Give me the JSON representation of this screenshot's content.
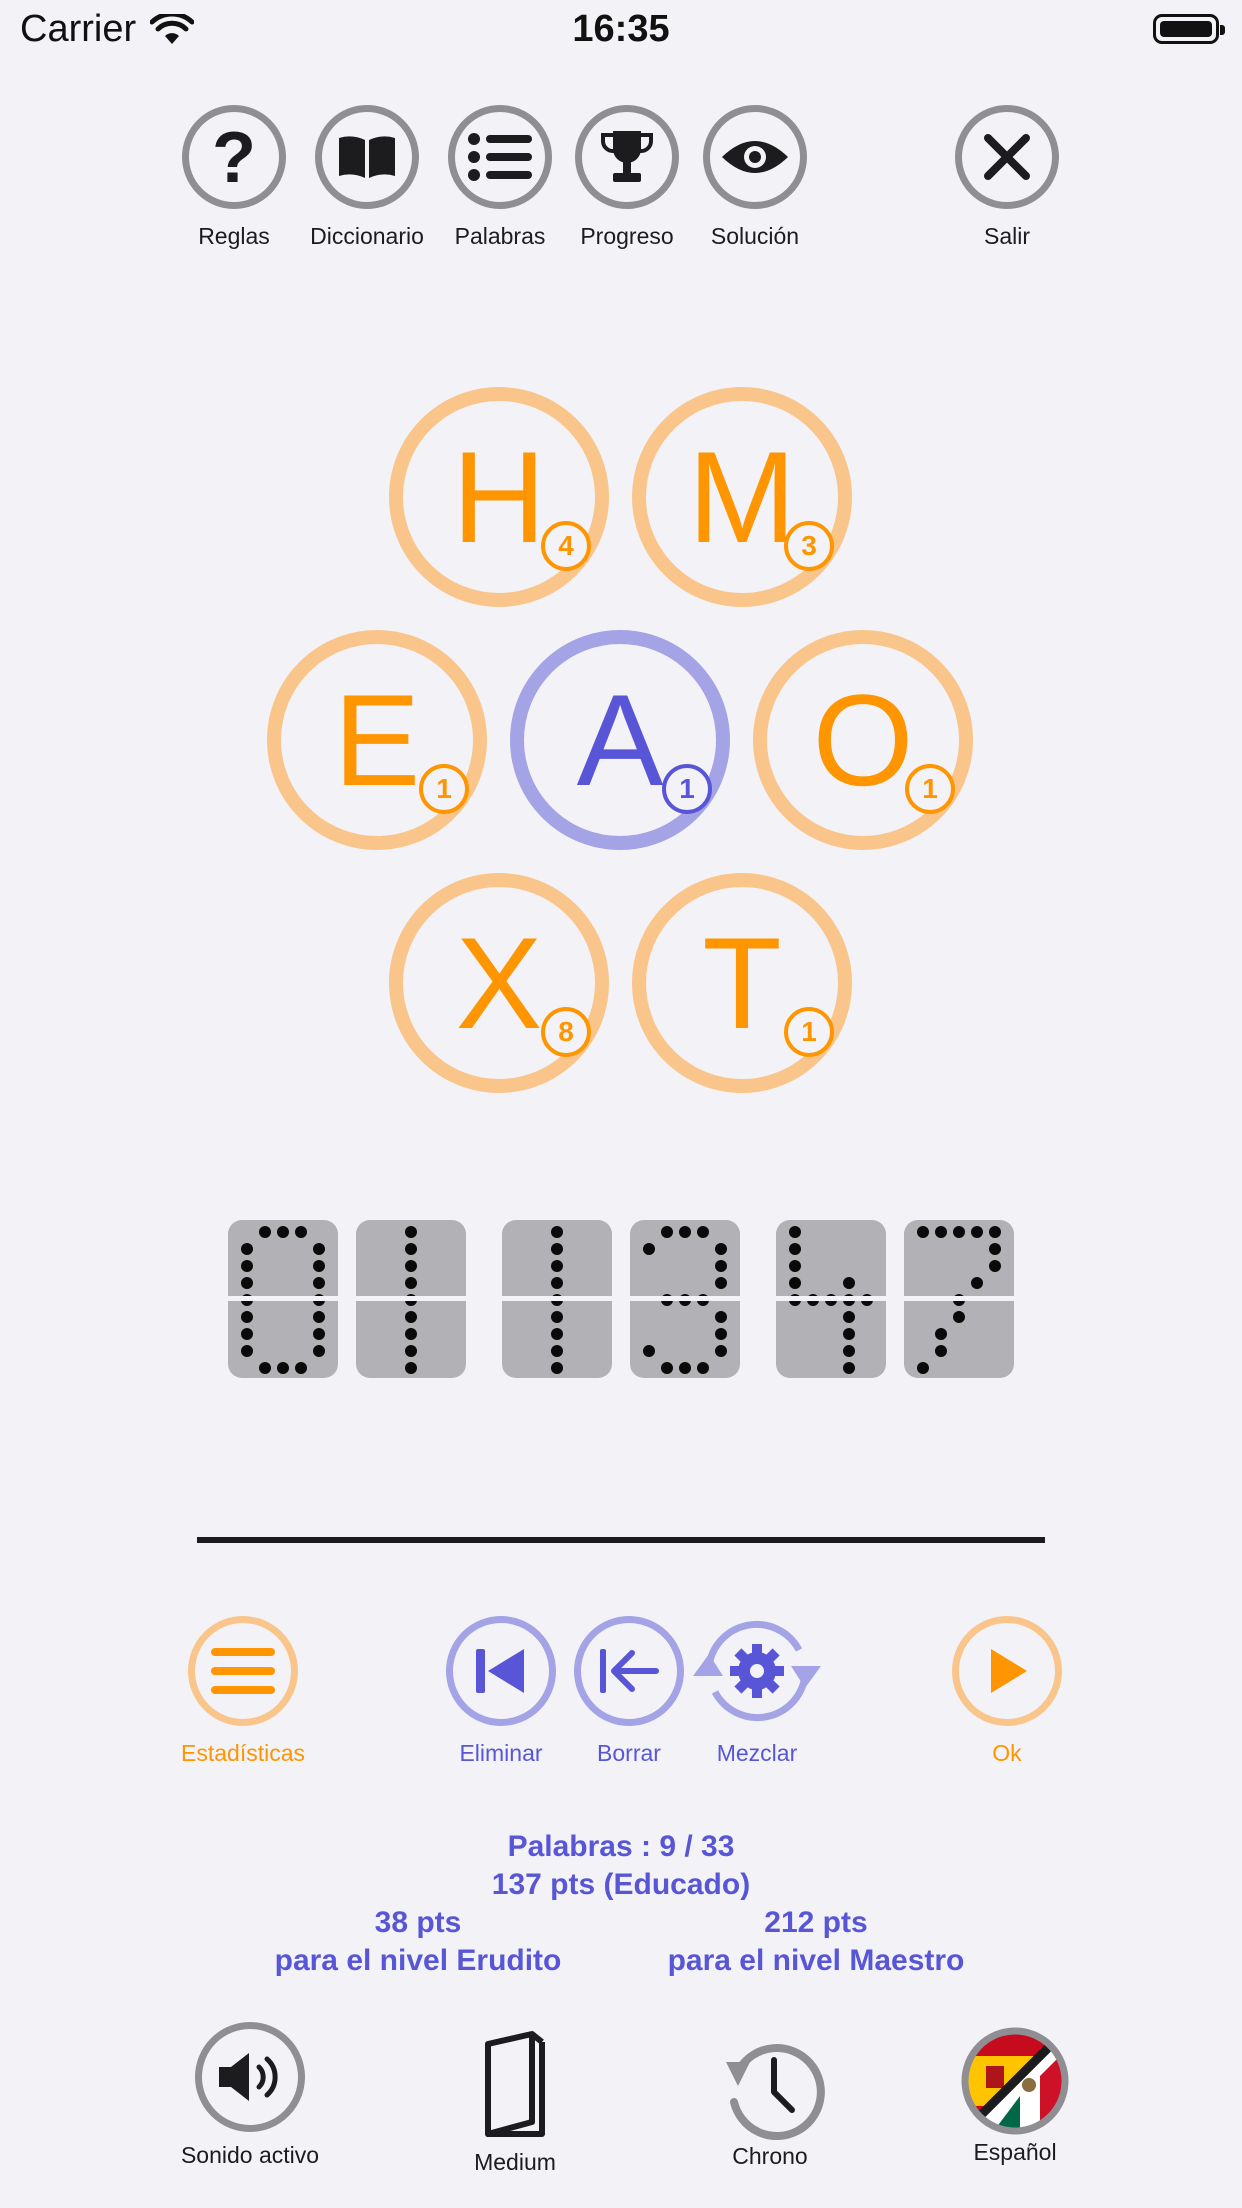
{
  "status_bar": {
    "carrier": "Carrier",
    "time": "16:35"
  },
  "toolbar": {
    "rules": "Reglas",
    "dictionary": "Diccionario",
    "words": "Palabras",
    "progress": "Progreso",
    "solution": "Solución",
    "exit": "Salir"
  },
  "tiles": [
    {
      "letter": "H",
      "points": "4"
    },
    {
      "letter": "M",
      "points": "3"
    },
    {
      "letter": "E",
      "points": "1"
    },
    {
      "letter": "A",
      "points": "1"
    },
    {
      "letter": "O",
      "points": "1"
    },
    {
      "letter": "X",
      "points": "8"
    },
    {
      "letter": "T",
      "points": "1"
    }
  ],
  "counter": {
    "digits": [
      "0",
      "1",
      "1",
      "3",
      "4",
      "7"
    ]
  },
  "actions": {
    "stats": "Estadísticas",
    "delete": "Eliminar",
    "erase": "Borrar",
    "shuffle": "Mezclar",
    "ok": "Ok"
  },
  "score": {
    "words": "Palabras : 9 / 33",
    "points": "137 pts (Educado)",
    "next_pts_a": "38 pts",
    "next_level_a": "para el nivel Erudito",
    "next_pts_b": "212 pts",
    "next_level_b": "para el nivel Maestro"
  },
  "bottom_bar": {
    "sound": "Sonido activo",
    "difficulty": "Medium",
    "chrono": "Chrono",
    "language": "Español"
  },
  "colors": {
    "accent_orange": "#ff9500",
    "accent_purple": "#5856d6",
    "ring_gray": "#8e8e93",
    "background": "#f2f2f7"
  }
}
